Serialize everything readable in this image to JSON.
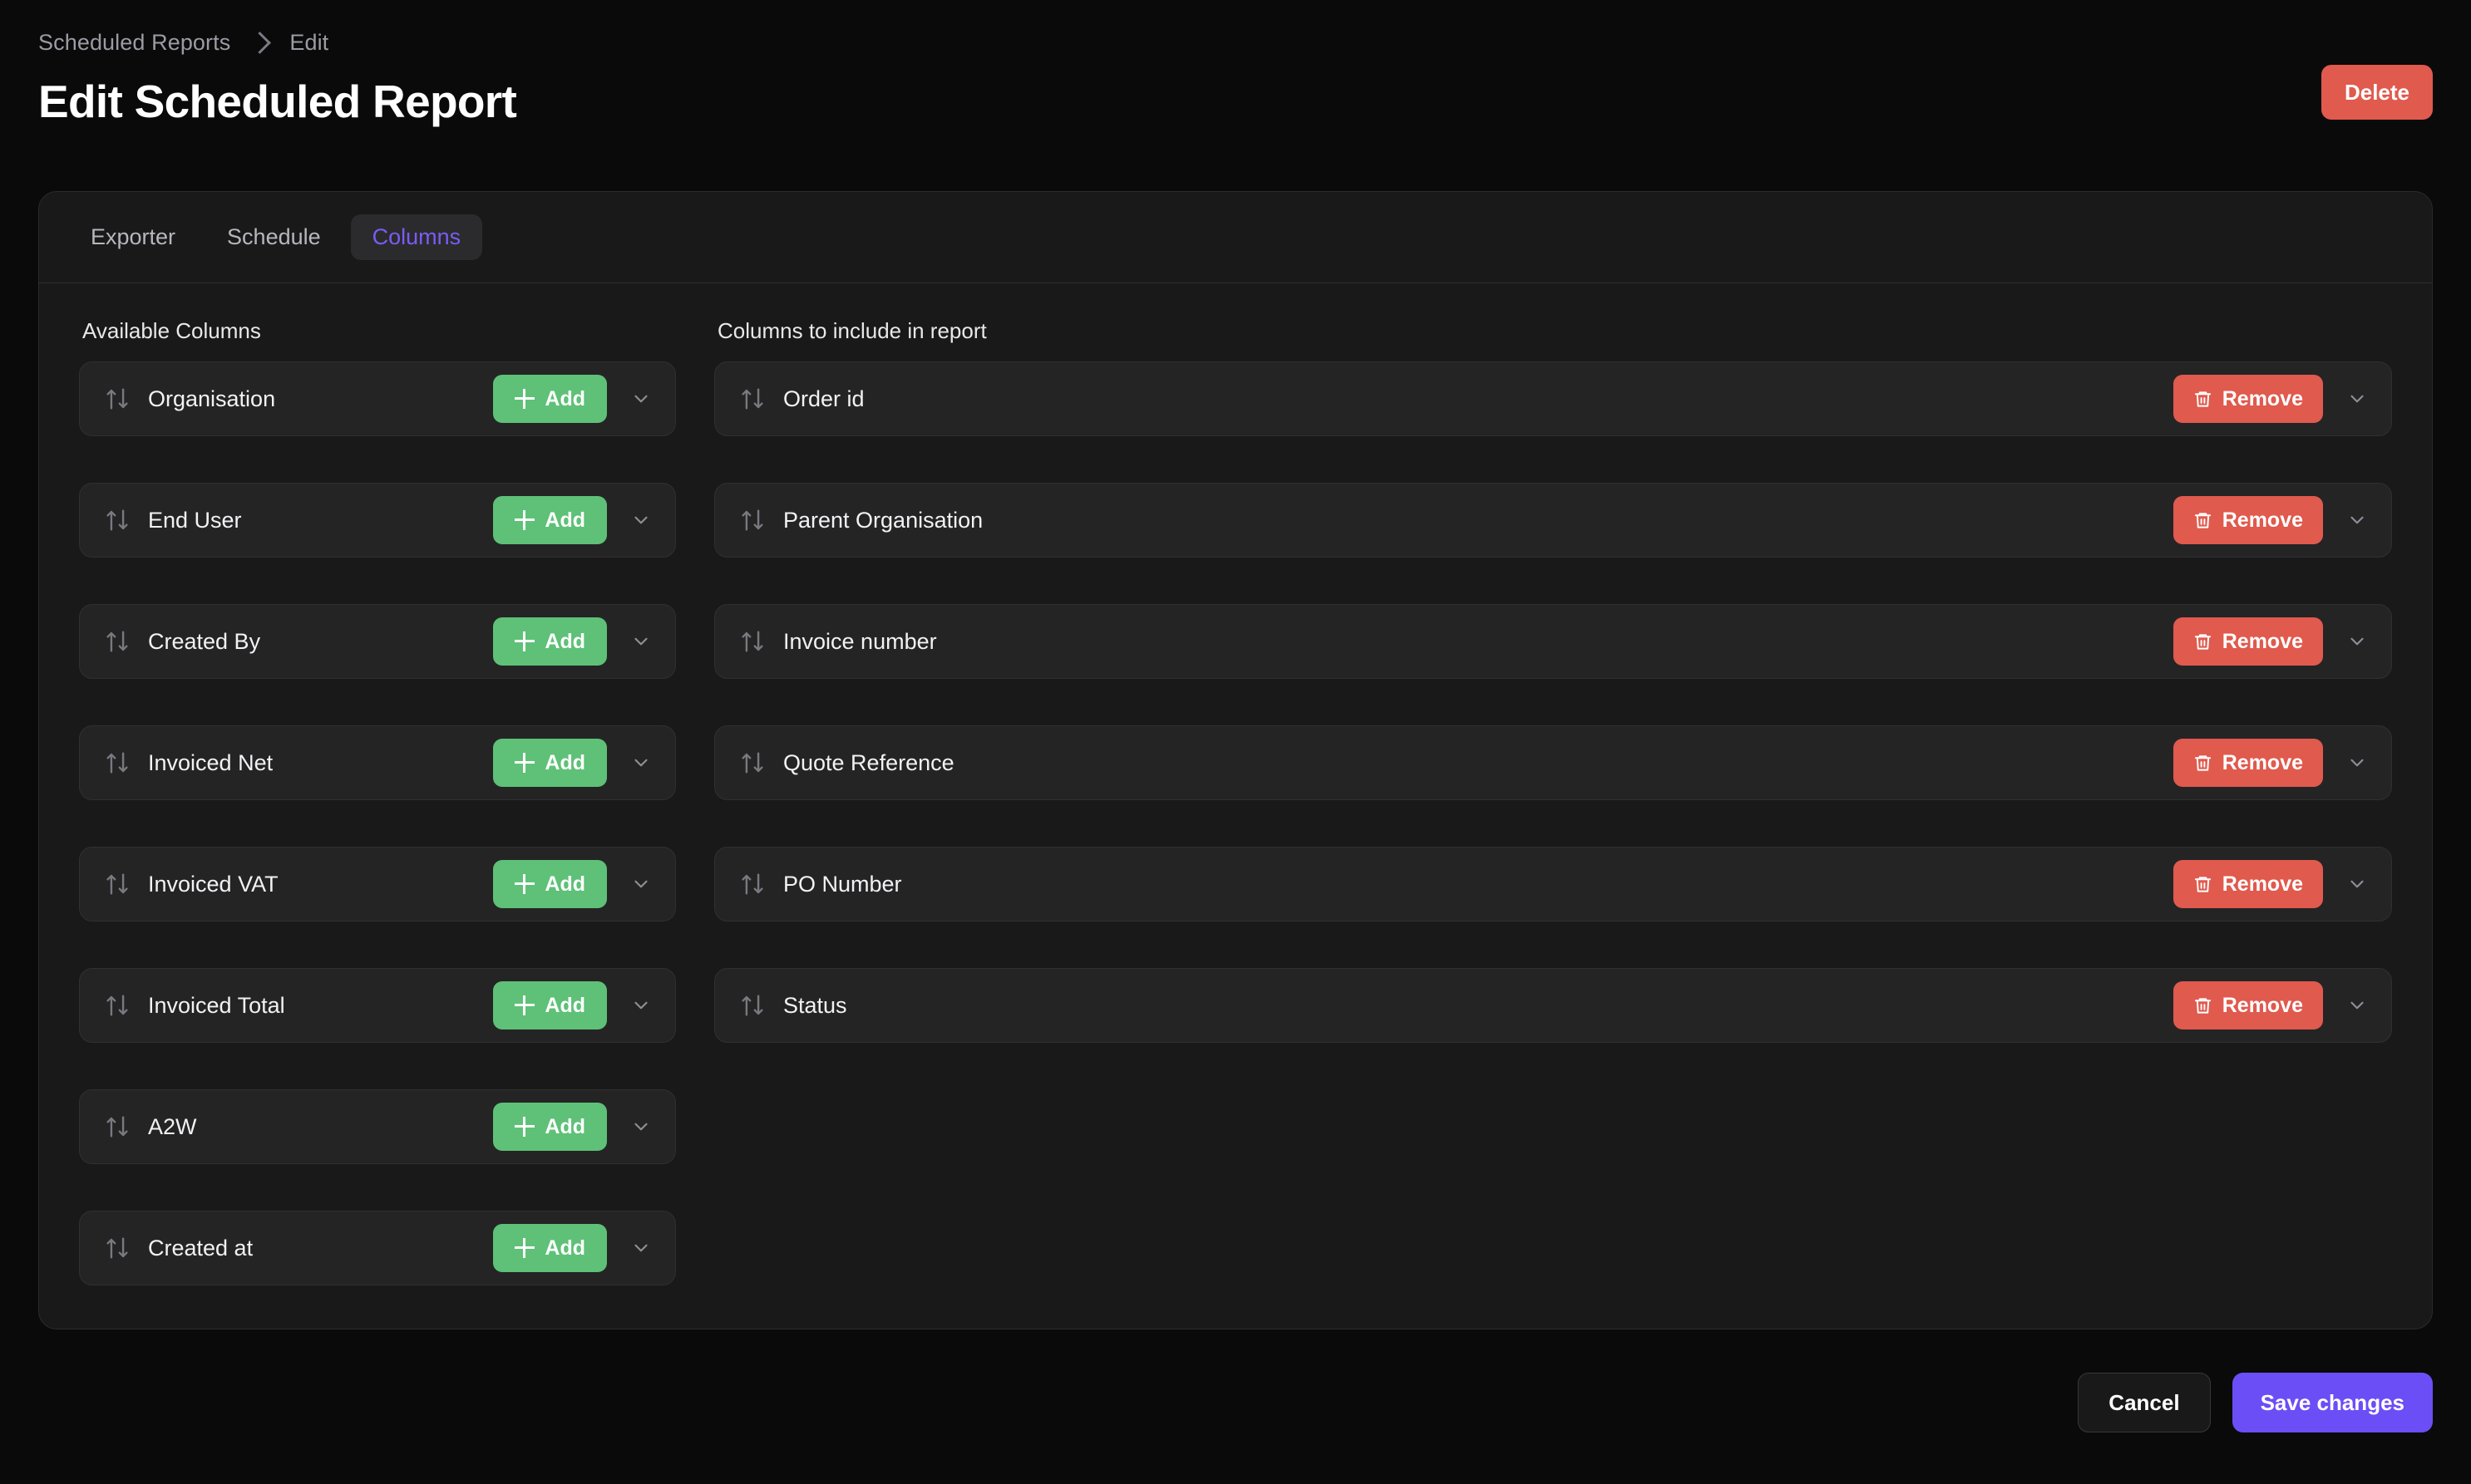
{
  "breadcrumb": {
    "items": [
      "Scheduled Reports",
      "Edit"
    ],
    "separator_icon": "chevron-right-icon"
  },
  "header": {
    "title": "Edit Scheduled Report",
    "delete_label": "Delete"
  },
  "tabs": [
    {
      "label": "Exporter",
      "active": false
    },
    {
      "label": "Schedule",
      "active": false
    },
    {
      "label": "Columns",
      "active": true
    }
  ],
  "available": {
    "heading": "Available Columns",
    "action_label": "Add",
    "action_icon": "plus-icon",
    "drag_icon": "sort-updown-icon",
    "expand_icon": "chevron-down-icon",
    "items": [
      {
        "label": "Organisation"
      },
      {
        "label": "End User"
      },
      {
        "label": "Created By"
      },
      {
        "label": "Invoiced Net"
      },
      {
        "label": "Invoiced VAT"
      },
      {
        "label": "Invoiced Total"
      },
      {
        "label": "A2W"
      },
      {
        "label": "Created at"
      }
    ]
  },
  "included": {
    "heading": "Columns to include in report",
    "action_label": "Remove",
    "action_icon": "trash-icon",
    "drag_icon": "sort-updown-icon",
    "expand_icon": "chevron-down-icon",
    "items": [
      {
        "label": "Order id"
      },
      {
        "label": "Parent Organisation"
      },
      {
        "label": "Invoice number"
      },
      {
        "label": "Quote Reference"
      },
      {
        "label": "PO Number"
      },
      {
        "label": "Status"
      }
    ]
  },
  "footer": {
    "cancel_label": "Cancel",
    "save_label": "Save changes"
  },
  "colors": {
    "page_background": "#0a0a0b",
    "card_background": "#191919",
    "row_background": "#242425",
    "accent_primary": "#6c4ef6",
    "accent_tab_active_text": "#7a5cf5",
    "success": "#5ec177",
    "danger": "#e05a4e",
    "muted_text": "#9b9ba3"
  }
}
